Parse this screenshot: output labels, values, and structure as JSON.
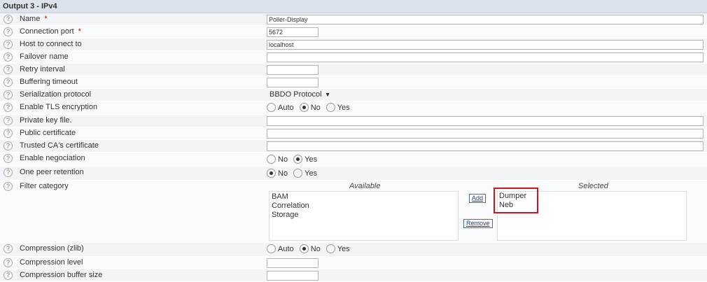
{
  "header": {
    "title": "Output 3 - IPv4"
  },
  "help_glyph": "?",
  "required_mark": "*",
  "rows": {
    "name": {
      "label": "Name",
      "value": "Poller-Display"
    },
    "port": {
      "label": "Connection port",
      "value": "5672"
    },
    "host": {
      "label": "Host to connect to",
      "value": "localhost"
    },
    "failover": {
      "label": "Failover name",
      "value": ""
    },
    "retry": {
      "label": "Retry interval",
      "value": ""
    },
    "buffering": {
      "label": "Buffering timeout",
      "value": ""
    },
    "serialization": {
      "label": "Serialization protocol",
      "value": "BBDO Protocol"
    },
    "tls": {
      "label": "Enable TLS encryption",
      "options": [
        "Auto",
        "No",
        "Yes"
      ],
      "selected": "No"
    },
    "privkey": {
      "label": "Private key file.",
      "value": ""
    },
    "pubcert": {
      "label": "Public certificate",
      "value": ""
    },
    "cacert": {
      "label": "Trusted CA's certificate",
      "value": ""
    },
    "negociation": {
      "label": "Enable negociation",
      "options": [
        "No",
        "Yes"
      ],
      "selected": "Yes"
    },
    "peer": {
      "label": "One peer retention",
      "options": [
        "No",
        "Yes"
      ],
      "selected": "No"
    },
    "filter": {
      "label": "Filter category",
      "available_label": "Available",
      "selected_label": "Selected",
      "available": [
        "BAM",
        "Correlation",
        "Storage"
      ],
      "selected": [
        "Dumper",
        "Neb"
      ],
      "add_label": "Add",
      "remove_label": "Remove"
    },
    "compression": {
      "label": "Compression (zlib)",
      "options": [
        "Auto",
        "No",
        "Yes"
      ],
      "selected": "No"
    },
    "comp_level": {
      "label": "Compression level",
      "value": ""
    },
    "comp_buffer": {
      "label": "Compression buffer size",
      "value": ""
    }
  },
  "colors": {
    "highlight": "#d2141e",
    "header_bg": "#dde3eb"
  },
  "icons": {
    "help": "question-circle-icon",
    "dropdown": "down-triangle-icon"
  }
}
